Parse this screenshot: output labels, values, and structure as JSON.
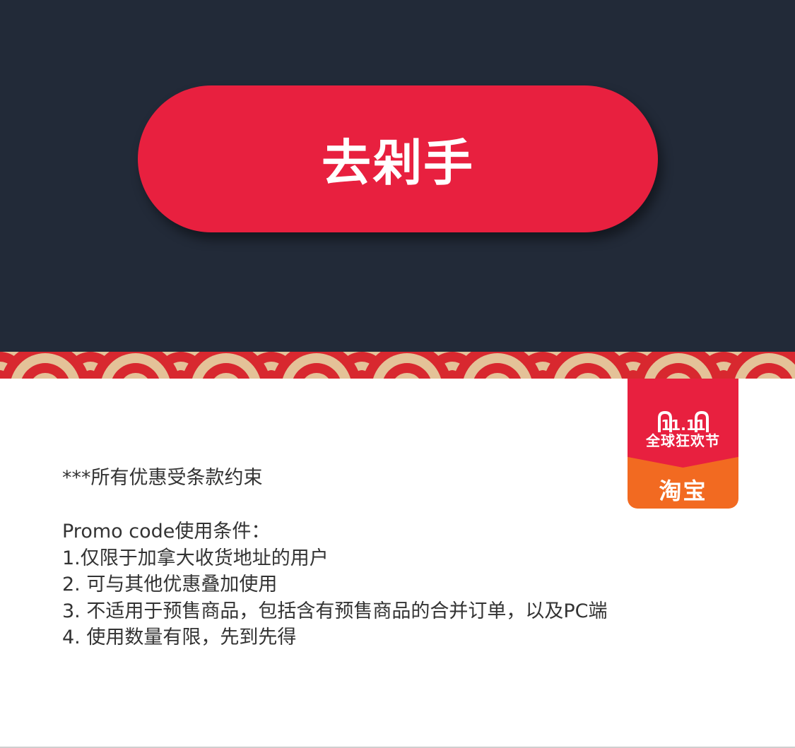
{
  "cta": {
    "label": "去剁手"
  },
  "badge": {
    "event_label": "11.11",
    "subtitle": "全球狂欢节",
    "brand": "淘宝"
  },
  "disclaimer": "***所有优惠受条款约束",
  "terms": {
    "heading": "Promo code使用条件：",
    "items": [
      "1.仅限于加拿大收货地址的用户",
      "2. 可与其他优惠叠加使用",
      "3. 不适用于预售商品，包括含有预售商品的合并订单，以及PC端",
      "4. 使用数量有限，先到先得"
    ]
  },
  "colors": {
    "background_dark": "#222a38",
    "button_red": "#e8203f",
    "wave_red": "#d8282f",
    "wave_tan": "#e4c298",
    "badge_orange": "#f26a21",
    "text": "#333333"
  }
}
